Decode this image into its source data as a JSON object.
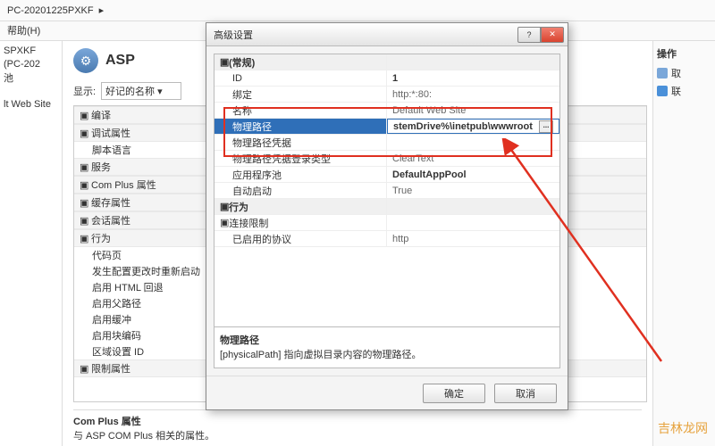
{
  "breadcrumb": {
    "path": "PC-20201225PXKF",
    "sep": "▸"
  },
  "menubar": {
    "help": "帮助(H)"
  },
  "left_panel": {
    "line1": "SPXKF (PC-202",
    "line2": "池",
    "line3": "lt Web Site"
  },
  "right_panel": {
    "title": "操作",
    "items": [
      "取",
      "联"
    ]
  },
  "asp": {
    "title": "ASP"
  },
  "display": {
    "label": "显示:",
    "value": "好记的名称"
  },
  "categories": [
    {
      "type": "g",
      "label": "编译"
    },
    {
      "type": "g",
      "label": "调试属性"
    },
    {
      "type": "i",
      "label": "脚本语言"
    },
    {
      "type": "g",
      "label": "服务"
    },
    {
      "type": "g",
      "label": "Com Plus 属性"
    },
    {
      "type": "g",
      "label": "缓存属性"
    },
    {
      "type": "g",
      "label": "会话属性"
    },
    {
      "type": "g",
      "label": "行为"
    },
    {
      "type": "i",
      "label": "代码页"
    },
    {
      "type": "i",
      "label": "发生配置更改时重新启动"
    },
    {
      "type": "i",
      "label": "启用 HTML 回退"
    },
    {
      "type": "i",
      "label": "启用父路径"
    },
    {
      "type": "i",
      "label": "启用缓冲"
    },
    {
      "type": "i",
      "label": "启用块编码"
    },
    {
      "type": "i",
      "label": "区域设置 ID"
    },
    {
      "type": "g",
      "label": "限制属性"
    }
  ],
  "footer": {
    "title": "Com Plus 属性",
    "desc": "与 ASP COM Plus 相关的属性。"
  },
  "dialog": {
    "title": "高级设置",
    "ok": "确定",
    "cancel": "取消",
    "desc_title": "物理路径",
    "desc_text": "[physicalPath] 指向虚拟目录内容的物理路径。",
    "groups": [
      {
        "label": "(常规)",
        "rows": [
          {
            "k": "ID",
            "v": "1",
            "bold": true
          },
          {
            "k": "绑定",
            "v": "http:*:80:",
            "plain": true
          },
          {
            "k": "名称",
            "v": "Default Web Site",
            "plain": true
          },
          {
            "k": "物理路径",
            "v": "stemDrive%\\inetpub\\wwwroot",
            "bold": true,
            "selected": true,
            "browse": true
          },
          {
            "k": "物理路径凭据",
            "v": "",
            "plain": true
          },
          {
            "k": "物理路径凭据登录类型",
            "v": "ClearText",
            "plain": true
          },
          {
            "k": "应用程序池",
            "v": "DefaultAppPool",
            "bold": true
          },
          {
            "k": "自动启动",
            "v": "True",
            "plain": true
          }
        ]
      },
      {
        "label": "行为",
        "rows": [
          {
            "k": "连接限制",
            "v": "",
            "plain": true,
            "groupish": true
          },
          {
            "k": "已启用的协议",
            "v": "http",
            "plain": true
          }
        ]
      }
    ]
  },
  "watermark": "吉林龙网"
}
